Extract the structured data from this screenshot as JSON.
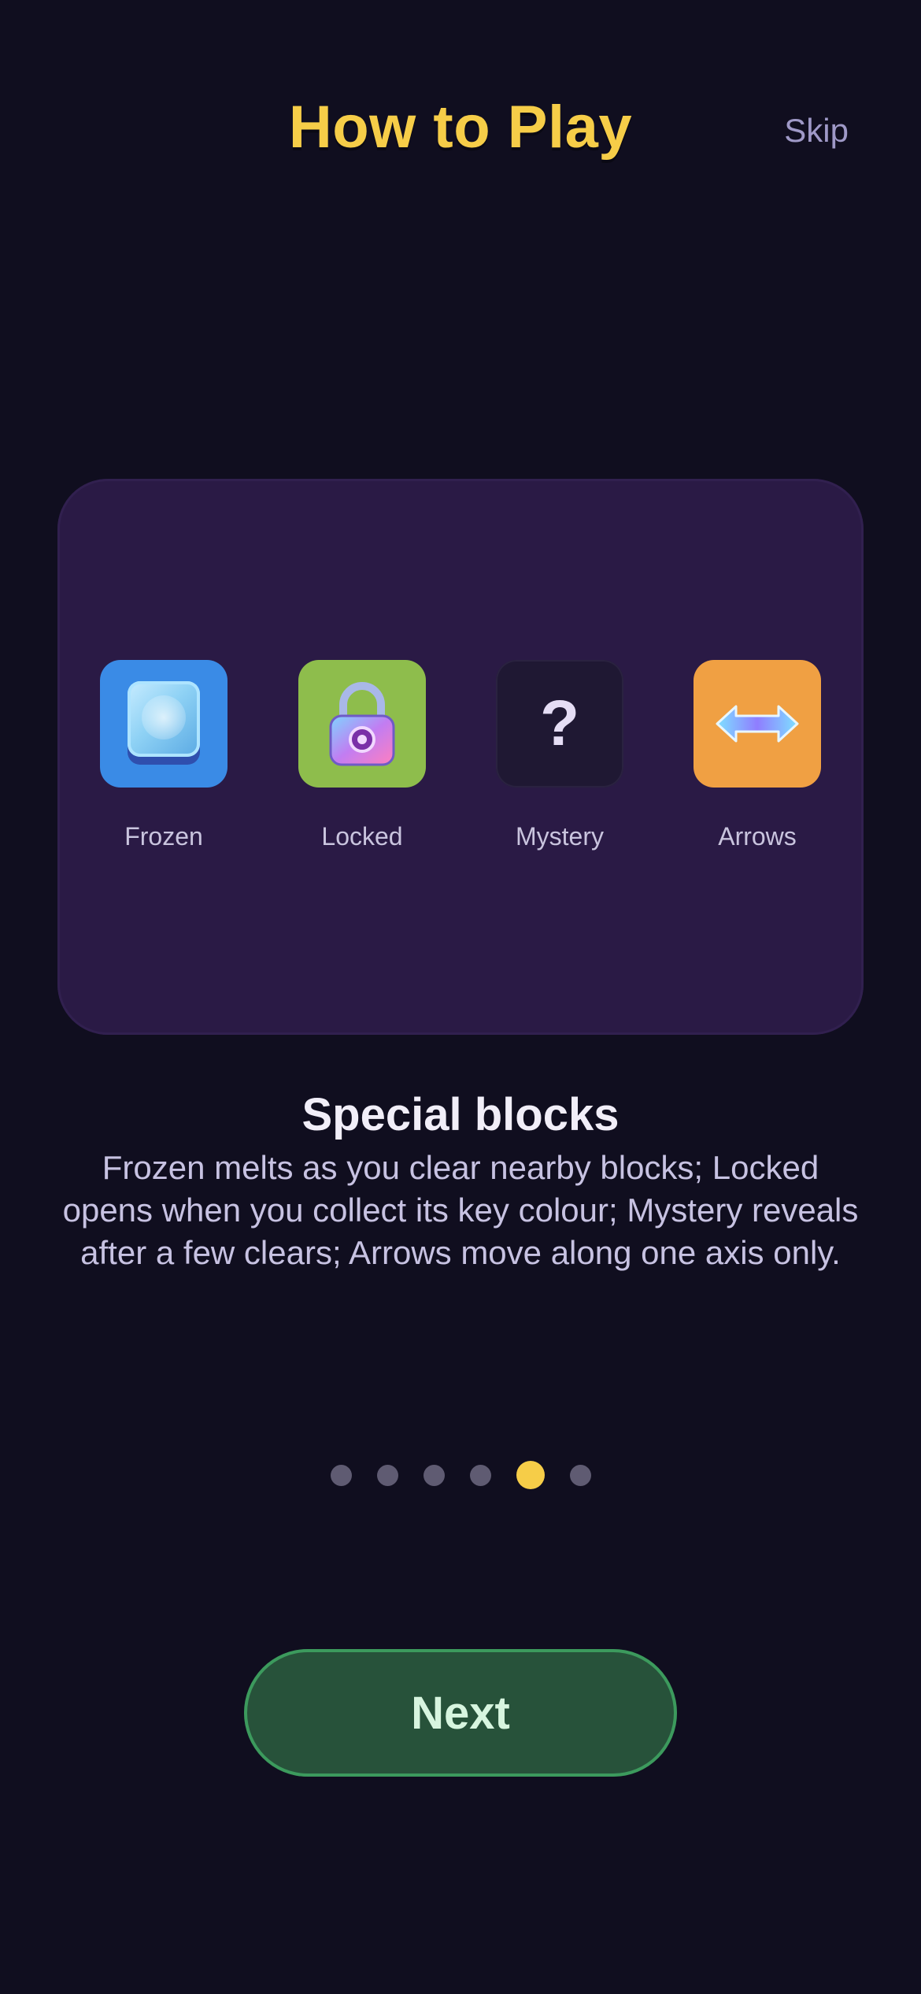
{
  "header": {
    "title": "How to Play",
    "skip_label": "Skip"
  },
  "card": {
    "blocks": [
      {
        "label": "Frozen",
        "icon": "ice-block-icon",
        "tile_color": "#3a8be6"
      },
      {
        "label": "Locked",
        "icon": "padlock-icon",
        "tile_color": "#8ebd4c"
      },
      {
        "label": "Mystery",
        "icon": "question-mark-icon",
        "symbol": "?",
        "tile_color": "#1f1833"
      },
      {
        "label": "Arrows",
        "icon": "double-arrow-icon",
        "tile_color": "#f0a043"
      }
    ]
  },
  "page": {
    "subtitle": "Special blocks",
    "description": "Frozen melts as you clear nearby blocks; Locked opens when you collect its key colour; Mystery reveals after a few clears; Arrows move along one axis only."
  },
  "pagination": {
    "total": 6,
    "current": 5,
    "active_color": "#f6cd48"
  },
  "footer": {
    "next_label": "Next"
  },
  "colors": {
    "background": "#100e1f",
    "title": "#f6cd48",
    "card": "#2a1a45",
    "next_button": "#27523a"
  }
}
